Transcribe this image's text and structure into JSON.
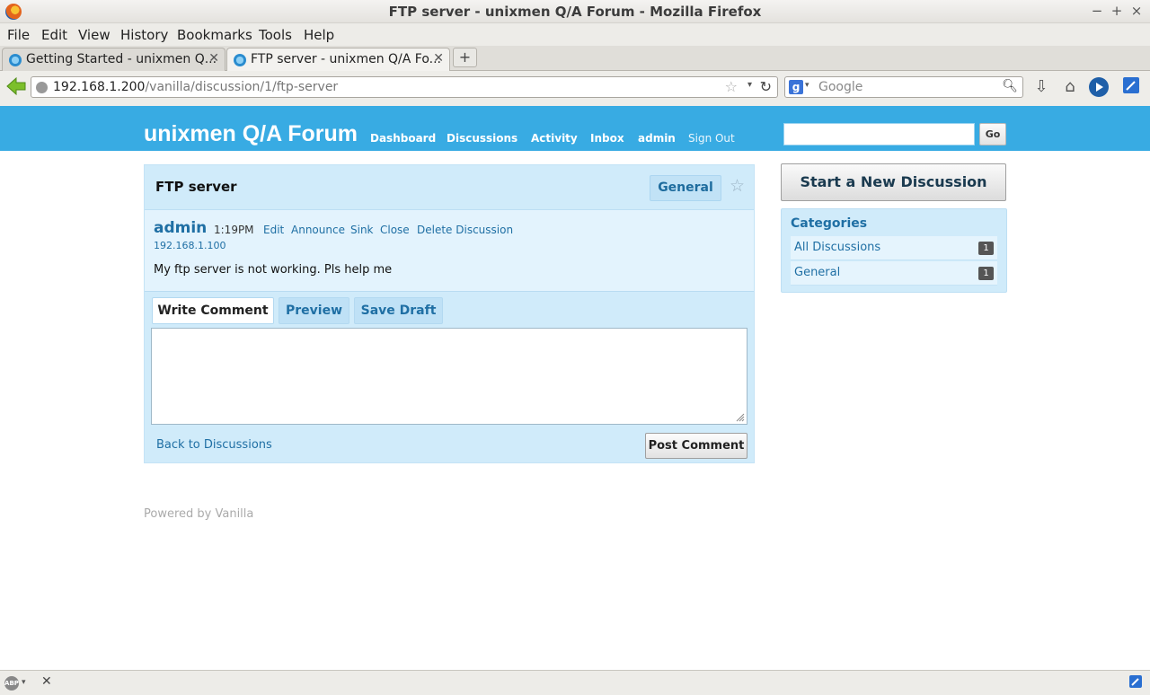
{
  "window": {
    "title": "FTP server - unixmen Q/A Forum - Mozilla Firefox",
    "controls": [
      "−",
      "+",
      "×"
    ]
  },
  "menu": [
    "File",
    "Edit",
    "View",
    "History",
    "Bookmarks",
    "Tools",
    "Help"
  ],
  "tabs": [
    {
      "label": "Getting Started - unixmen Q...",
      "active": false
    },
    {
      "label": "FTP server - unixmen Q/A Fo...",
      "active": true
    }
  ],
  "newtab_label": "+",
  "url": {
    "host": "192.168.1.200",
    "path": "/vanilla/discussion/1/ftp-server"
  },
  "browser_search": {
    "placeholder": "Google"
  },
  "site": {
    "brand": "unixmen Q/A Forum",
    "nav": [
      "Dashboard",
      "Discussions",
      "Activity",
      "Inbox",
      "admin",
      "Sign Out"
    ],
    "search_button": "Go"
  },
  "discussion": {
    "title": "FTP server",
    "category": "General",
    "author": "admin",
    "time": "1:19PM",
    "actions": [
      "Edit",
      "Announce",
      "Sink",
      "Close",
      "Delete Discussion"
    ],
    "ip": "192.168.1.100",
    "body": "My ftp server is not working. Pls help me"
  },
  "comment": {
    "tabs": [
      "Write Comment",
      "Preview",
      "Save Draft"
    ],
    "back_link": "Back to Discussions",
    "post_button": "Post Comment"
  },
  "sidebar": {
    "new_discussion": "Start a New Discussion",
    "categories_heading": "Categories",
    "categories": [
      {
        "label": "All Discussions",
        "count": "1"
      },
      {
        "label": "General",
        "count": "1"
      }
    ]
  },
  "footer": "Powered by Vanilla",
  "status": {
    "adblock_label": "ABP",
    "close_glyph": "✕"
  },
  "colors": {
    "banner": "#38abe3",
    "link": "#1f6fa4",
    "panel": "#d0ebfa"
  }
}
